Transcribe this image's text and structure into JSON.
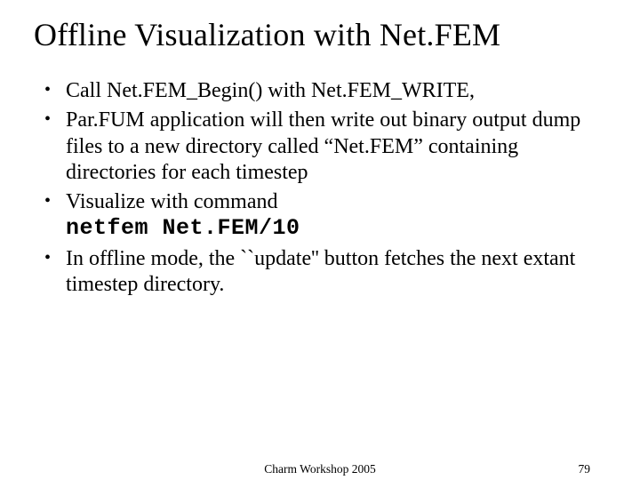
{
  "title": "Offline Visualization with Net.FEM",
  "bullets": [
    {
      "pre": "Call Net.FEM_Begin() with Net.FEM_WRITE,",
      "code": "",
      "post": ""
    },
    {
      "pre": "Par.FUM application will then write out binary output dump files to a new directory called “Net.FEM” containing directories for each timestep",
      "code": "",
      "post": ""
    },
    {
      "pre": "Visualize with command",
      "code": "netfem Net.FEM/10",
      "post": ""
    },
    {
      "pre": "In offline mode, the ``update'' button fetches the next extant timestep directory.",
      "code": "",
      "post": ""
    }
  ],
  "footer": {
    "center": "Charm Workshop 2005",
    "pagenum": "79"
  }
}
